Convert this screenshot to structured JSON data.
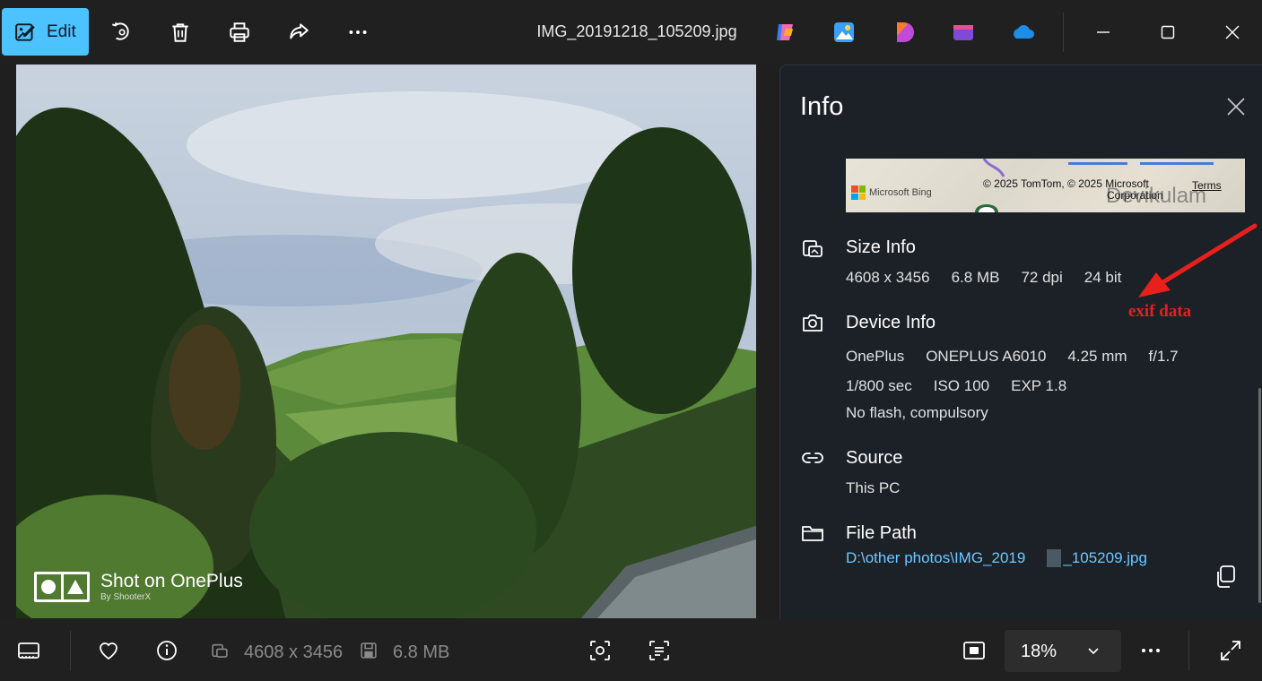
{
  "toolbar": {
    "edit_label": "Edit",
    "file_name": "IMG_20191218_105209.jpg",
    "icons": [
      "rotate-icon",
      "delete-icon",
      "print-icon",
      "share-icon",
      "more-icon"
    ],
    "apps": [
      "copilot-icon",
      "designer-icon",
      "clipchamp-icon",
      "photos-app-icon",
      "onedrive-icon"
    ]
  },
  "photo": {
    "watermark_main": "Shot on OnePlus",
    "watermark_sub": "By ShooterX"
  },
  "info_panel": {
    "title": "Info",
    "map": {
      "bing_label": "Microsoft Bing",
      "copyright_line1": "© 2025 TomTom, © 2025 Microsoft",
      "copyright_line2": "Corporation",
      "terms": "Terms",
      "place_label": "Devikulam"
    },
    "size_info": {
      "heading": "Size Info",
      "dimensions": "4608 x 3456",
      "file_size": "6.8 MB",
      "dpi": "72 dpi",
      "bit_depth": "24 bit"
    },
    "device_info": {
      "heading": "Device Info",
      "brand": "OnePlus",
      "model": "ONEPLUS A6010",
      "focal_length": "4.25 mm",
      "aperture": "f/1.7",
      "shutter": "1/800 sec",
      "iso": "ISO 100",
      "exposure": "EXP 1.8",
      "flash": "No flash, compulsory"
    },
    "source": {
      "heading": "Source",
      "value": "This PC"
    },
    "file_path": {
      "heading": "File Path",
      "part1": "D:\\other photos\\IMG_2019",
      "part2": "_105209.jpg"
    },
    "annotation": "exif data"
  },
  "bottombar": {
    "dimensions": "4608 x 3456",
    "file_size": "6.8 MB",
    "zoom": "18%"
  },
  "colors": {
    "accent": "#4cc2ff",
    "link": "#6cc8ff",
    "annotation": "#e8201c"
  }
}
